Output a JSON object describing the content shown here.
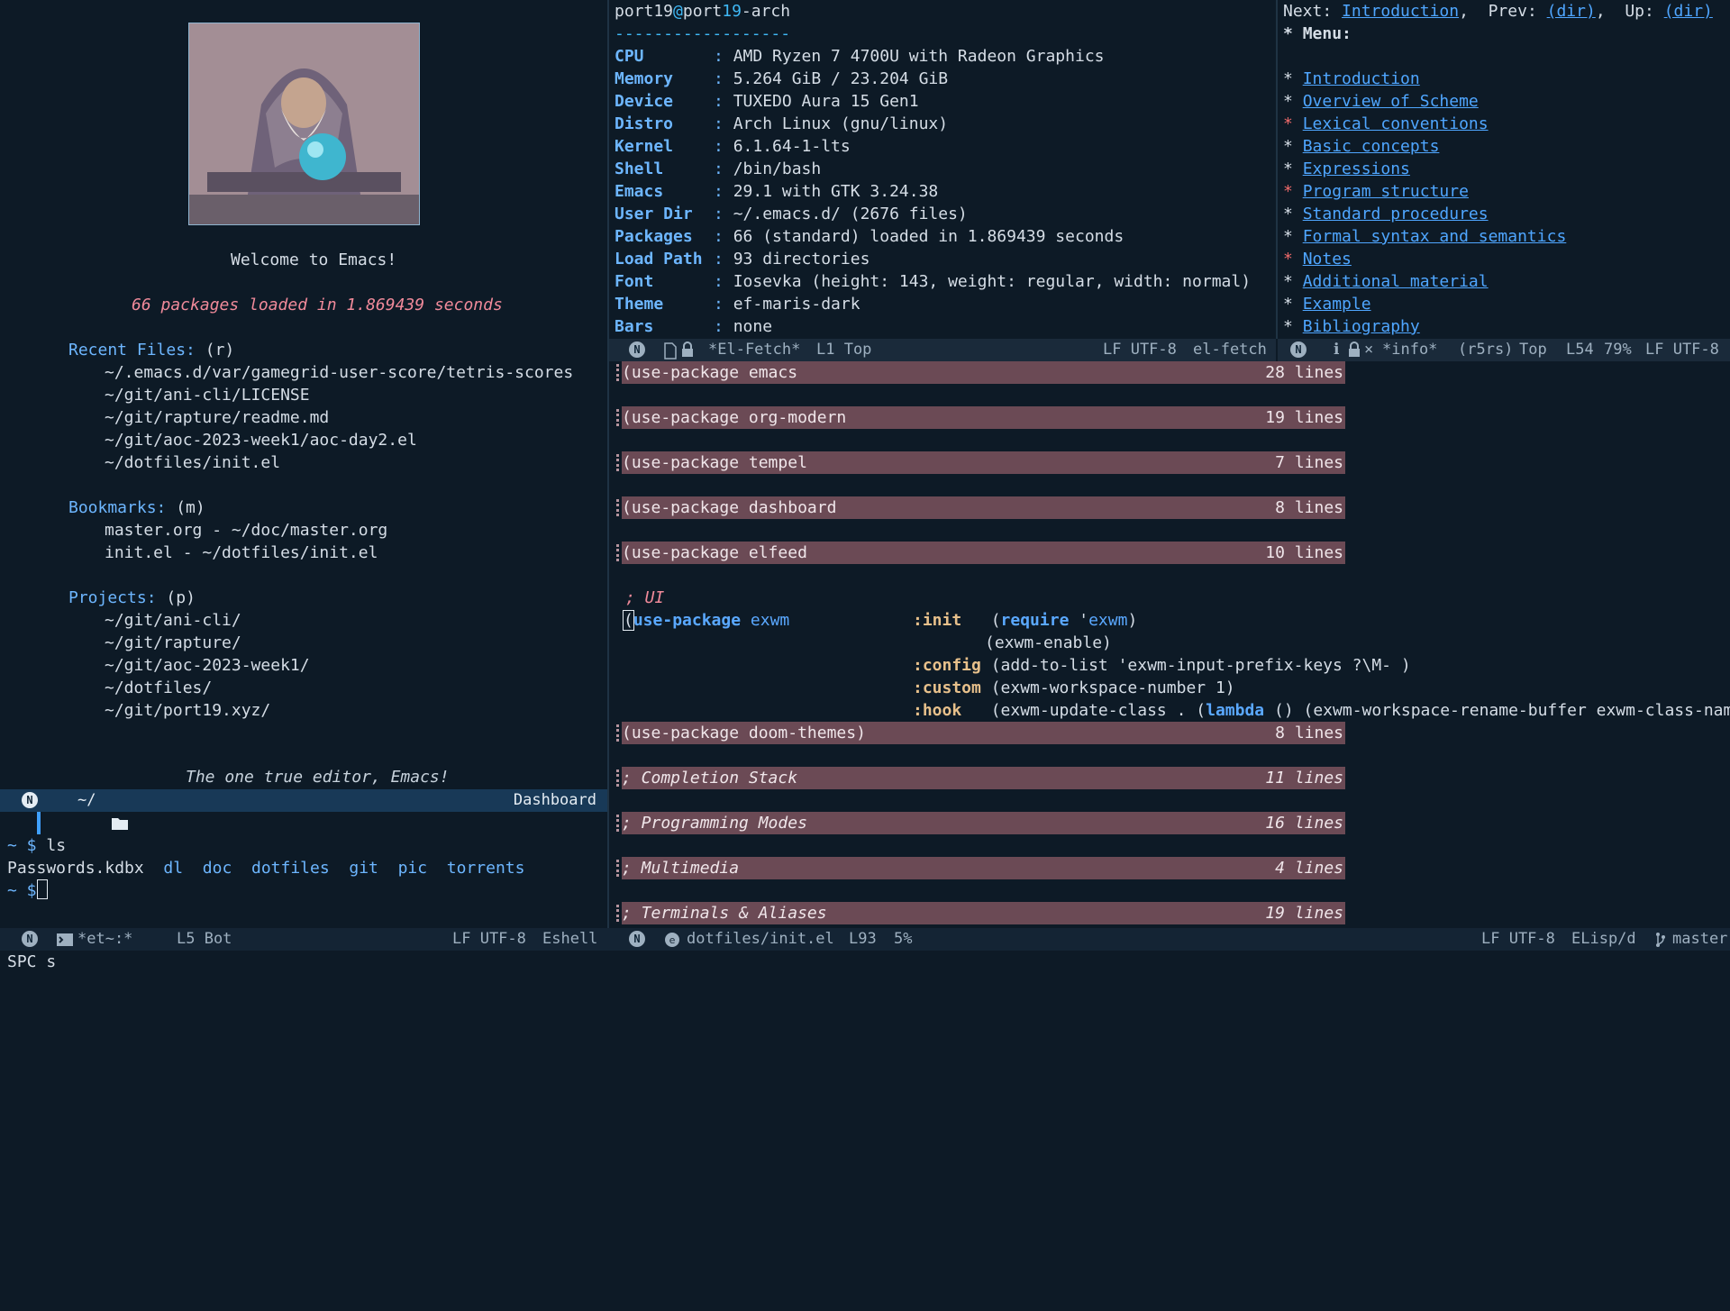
{
  "dashboard": {
    "welcome": "Welcome to Emacs!",
    "loaded": "66 packages loaded in 1.869439 seconds",
    "recent_files_label": "Recent Files:",
    "recent_files_key": "(r)",
    "recent_files": [
      "~/.emacs.d/var/gamegrid-user-score/tetris-scores",
      "~/git/ani-cli/LICENSE",
      "~/git/rapture/readme.md",
      "~/git/aoc-2023-week1/aoc-day2.el",
      "~/dotfiles/init.el"
    ],
    "bookmarks_label": "Bookmarks:",
    "bookmarks_key": "(m)",
    "bookmarks": [
      "master.org - ~/doc/master.org",
      "init.el - ~/dotfiles/init.el"
    ],
    "projects_label": "Projects:",
    "projects_key": "(p)",
    "projects": [
      "~/git/ani-cli/",
      "~/git/rapture/",
      "~/git/aoc-2023-week1/",
      "~/dotfiles/",
      "~/git/port19.xyz/"
    ],
    "footer": "The one true editor, Emacs!",
    "modeline": {
      "badge": "N",
      "path": "~/",
      "mode": "Dashboard"
    }
  },
  "eshell": {
    "prompt1": "~ $ ",
    "cmd1": "ls",
    "listing": [
      "Passwords.kdbx",
      "dl",
      "doc",
      "dotfiles",
      "git",
      "pic",
      "torrents"
    ],
    "prompt2": "~ $",
    "modeline": {
      "badge": "N",
      "buffer": "*et~:*",
      "pos": "L5 Bot",
      "encoding": "LF UTF-8",
      "mode": "Eshell"
    }
  },
  "elfetch": {
    "user": "port19",
    "at": "@",
    "host_a": "port",
    "host_b": "19",
    "host_c": "-arch",
    "separator": "------------------",
    "rows": [
      {
        "key": "CPU",
        "value": "AMD Ryzen 7 4700U with Radeon Graphics"
      },
      {
        "key": "Memory",
        "value": "5.264 GiB / 23.204 GiB"
      },
      {
        "key": "Device",
        "value": "TUXEDO Aura 15 Gen1"
      },
      {
        "key": "Distro",
        "value": "Arch Linux (gnu/linux)"
      },
      {
        "key": "Kernel",
        "value": "6.1.64-1-lts"
      },
      {
        "key": "Shell",
        "value": "/bin/bash"
      },
      {
        "key": "Emacs",
        "value": "29.1 with GTK 3.24.38"
      },
      {
        "key": "User Dir",
        "value": "~/.emacs.d/ (2676 files)"
      },
      {
        "key": "Packages",
        "value": "66 (standard) loaded in 1.869439 seconds"
      },
      {
        "key": "Load Path",
        "value": "93 directories"
      },
      {
        "key": "Font",
        "value": "Iosevka (height: 143, weight: regular, width: normal)"
      },
      {
        "key": "Theme",
        "value": "ef-maris-dark"
      },
      {
        "key": "Bars",
        "value": "none"
      }
    ],
    "modeline": {
      "badge": "N",
      "buffer": "*El-Fetch*",
      "pos": "L1 Top",
      "encoding": "LF UTF-8",
      "mode": "el-fetch"
    }
  },
  "info": {
    "nav_next_label": "Next:",
    "nav_next": "Introduction",
    "nav_prev_label": "Prev:",
    "nav_prev": "(dir)",
    "nav_up_label": "Up:",
    "nav_up": "(dir)",
    "menu_label": "Menu:",
    "items": [
      "Introduction",
      "Overview of Scheme",
      "Lexical conventions",
      "Basic concepts",
      "Expressions",
      "Program structure",
      "Standard procedures",
      "Formal syntax and semantics",
      "Notes",
      "Additional material",
      "Example",
      "Bibliography"
    ],
    "modeline": {
      "badge": "N",
      "buffer": "*info*",
      "node": "(r5rs)",
      "pos": "Top",
      "line": "L54",
      "pct": "79%",
      "encoding": "LF UTF-8"
    }
  },
  "initel": {
    "folds": [
      {
        "text": "(use-package emacs",
        "count": "28 lines"
      },
      {
        "text": "(use-package org-modern",
        "count": "19 lines"
      },
      {
        "text": "(use-package tempel",
        "count": "7 lines"
      },
      {
        "text": "(use-package dashboard",
        "count": "8 lines"
      },
      {
        "text": "(use-package elfeed",
        "count": "10 lines"
      }
    ],
    "comment_ui": "; UI",
    "exwm": {
      "open": "(",
      "head": "use-package",
      "name": "exwm",
      "init_kw": ":init",
      "init_1a": "(",
      "init_1b": "require",
      "init_1c": " '",
      "init_1d": "exwm",
      "init_1e": ")",
      "init_2": "(exwm-enable)",
      "config_kw": ":config",
      "config": "(add-to-list 'exwm-input-prefix-keys ?\\M- )",
      "custom_kw": ":custom",
      "custom": "(exwm-workspace-number 1)",
      "hook_kw": ":hook",
      "hook_a": "(exwm-update-class . (",
      "hook_b": "lambda",
      "hook_c": " () (exwm-workspace-rename-buffer exwm-class-name))))"
    },
    "folds2": [
      {
        "text": "(use-package doom-themes)",
        "count": "8 lines",
        "italic": false
      },
      {
        "text": "; Completion Stack",
        "count": "11 lines",
        "italic": true
      },
      {
        "text": "; Programming Modes",
        "count": "16 lines",
        "italic": true
      },
      {
        "text": "; Multimedia",
        "count": "4 lines",
        "italic": true
      },
      {
        "text": "; Terminals & Aliases",
        "count": "19 lines",
        "italic": true
      }
    ],
    "modeline": {
      "badge": "N",
      "file": "dotfiles/init.el",
      "line": "L93",
      "pct": "5%",
      "encoding": "LF UTF-8",
      "mode": "ELisp/d",
      "branch": "master"
    }
  },
  "minibuffer": "SPC s"
}
